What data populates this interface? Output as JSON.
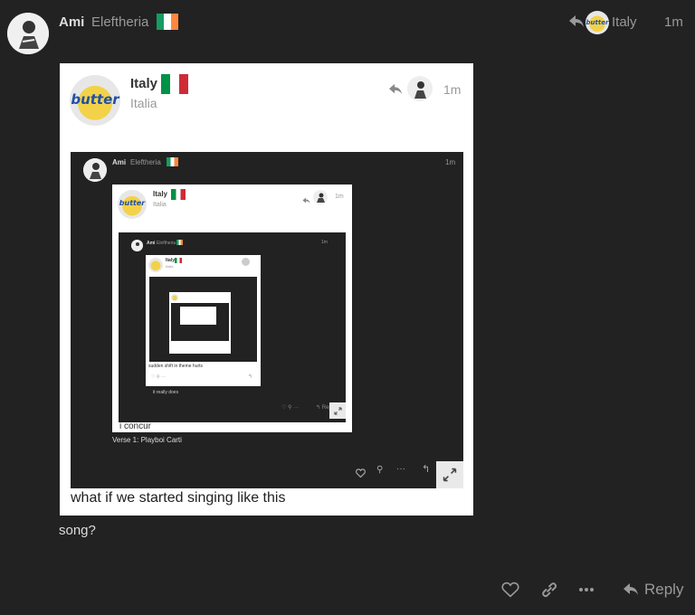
{
  "post": {
    "author_name": "Ami",
    "author_title": "Eleftheria",
    "reply_to_name": "Italy",
    "time": "1m",
    "body_text": "song?",
    "actions": {
      "reply_label": "Reply"
    }
  },
  "quote_1": {
    "author_name": "Italy",
    "author_title": "Italia",
    "time": "1m",
    "caption": "what if we started singing like this"
  },
  "quote_2": {
    "author_name": "Ami",
    "author_title": "Eleftheria",
    "time": "1m",
    "inner_author_name": "Italy",
    "inner_author_title": "Italia",
    "inner_time": "1m",
    "caption": "i concur",
    "subcaption": "Verse 1: Playboi Carti"
  },
  "quote_3": {
    "author_name": "Ami",
    "author_title": "Eleftheria",
    "time": "1m",
    "inner_author_name": "Italy",
    "inner_author_title": "Italia",
    "caption": "sudden shift in theme hurts",
    "subcaption": "it really does",
    "reply_label": "Reply"
  },
  "icons": {
    "logo_text": "butter"
  },
  "colors": {
    "background": "#222222",
    "card": "#ffffff",
    "muted": "#999999",
    "ireland_flag": [
      "#169b62",
      "#ffffff",
      "#ff883e"
    ],
    "italy_flag": [
      "#009246",
      "#ffffff",
      "#ce2b37"
    ]
  }
}
